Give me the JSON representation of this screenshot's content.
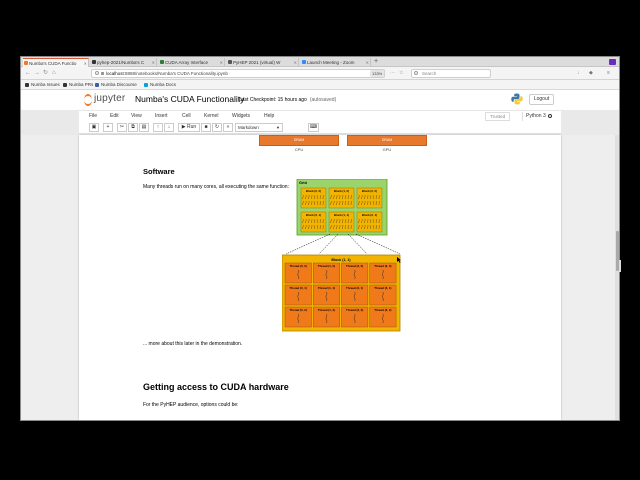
{
  "browser": {
    "tabs": [
      {
        "label": "Numba's CUDA Functio",
        "color": "#f37726",
        "active": true
      },
      {
        "label": "pyhep-2021/Numba's C",
        "color": "#333333",
        "active": false
      },
      {
        "label": "CUDA Array Interface",
        "color": "#2e7d32",
        "active": false
      },
      {
        "label": "PyHEP 2021 (virtual) W",
        "color": "#555555",
        "active": false
      },
      {
        "label": "Launch Meeting - Zoom",
        "color": "#2d8cff",
        "active": false
      }
    ],
    "new_tab": "+",
    "url_host": "localhost",
    "url_path": ":8888/notebooks/Numba's CUDA Functionality.ipynb",
    "zoom": "133%",
    "search_placeholder": "Search",
    "bookmarks": [
      {
        "label": "Numba Issues",
        "color": "#333333"
      },
      {
        "label": "Numba PRs",
        "color": "#333333"
      },
      {
        "label": "Numba Discourse",
        "color": "#3b5ea7"
      },
      {
        "label": "Numba Docs",
        "color": "#00a3e0"
      }
    ],
    "accent": "#f37726"
  },
  "jupyter": {
    "logo": "jupyter",
    "notebook_title": "Numba's CUDA Functionality",
    "checkpoint": "Last Checkpoint: 15 hours ago",
    "autosaved": "(autosaved)",
    "logout": "Logout",
    "menus": [
      "File",
      "Edit",
      "View",
      "Insert",
      "Cell",
      "Kernel",
      "Widgets",
      "Help"
    ],
    "trusted": "Trusted",
    "kernel_name": "Python 3",
    "run_label": "Run",
    "cell_type": "Markdown"
  },
  "content": {
    "hw_top": [
      {
        "label": "DRAM",
        "caption": "CPU"
      },
      {
        "label": "DRAM",
        "caption": "GPU"
      }
    ],
    "software_heading": "Software",
    "software_text": "Many threads run on many cores, all executing the same function:",
    "grid_label": "Grid",
    "blocks": [
      "Block (0, 0)",
      "Block (1, 0)",
      "Block (2, 0)",
      "Block (0, 1)",
      "Block (1, 1)",
      "Block (2, 1)"
    ],
    "zoom_block_label": "Block (1, 1)",
    "threads": [
      "Thread (0, 0)",
      "Thread (1, 0)",
      "Thread (2, 0)",
      "Thread (3, 0)",
      "Thread (0, 1)",
      "Thread (1, 1)",
      "Thread (2, 1)",
      "Thread (3, 1)",
      "Thread (0, 2)",
      "Thread (1, 2)",
      "Thread (2, 2)",
      "Thread (3, 2)"
    ],
    "more_text": "... more about this later in the demonstration.",
    "access_heading": "Getting access to CUDA hardware",
    "access_text": "For the PyHEP audience, options could be:"
  }
}
